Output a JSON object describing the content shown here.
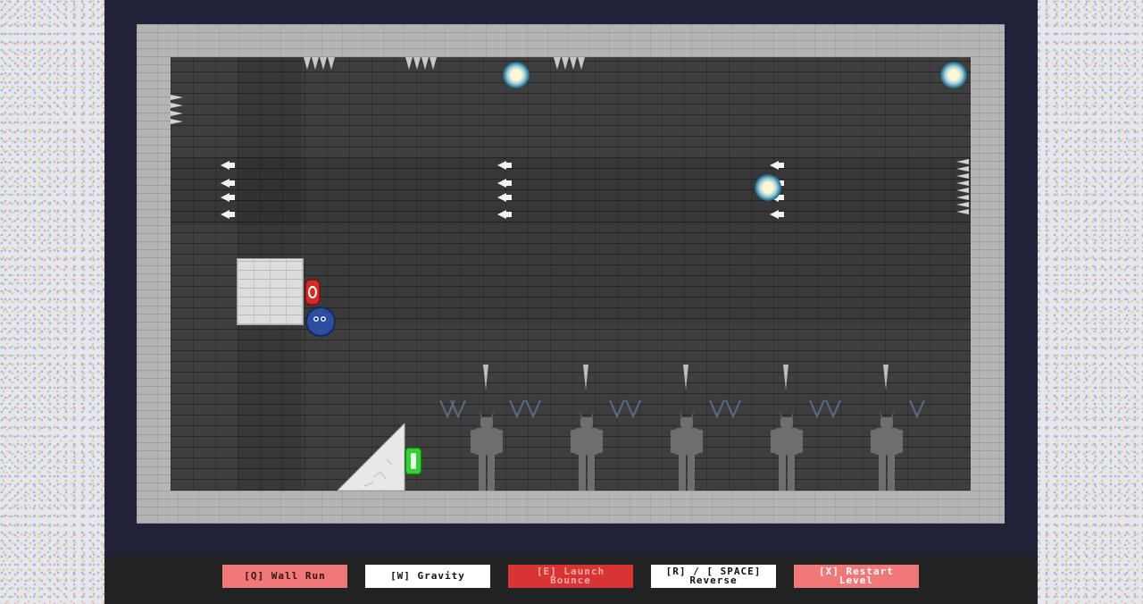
{
  "hud": {
    "abilities": [
      {
        "label": "[Q] Wall Run",
        "bg": "#f07878",
        "fg": "#3a1010"
      },
      {
        "label": "[W] Gravity",
        "bg": "#ffffff",
        "fg": "#111111"
      },
      {
        "label": "[E] Launch\nBounce",
        "bg": "#d83434",
        "fg": "#f4aaaa"
      },
      {
        "label": "[R] / [ SPACE]\nReverse",
        "bg": "#ffffff",
        "fg": "#111111"
      },
      {
        "label": "[X] Restart\nLevel",
        "bg": "#f07878",
        "fg": "#ffffff"
      }
    ]
  },
  "colors": {
    "frame": "#212138",
    "stone_wall": "#b4b4b4",
    "dungeon_bricks": "#3e3e3e",
    "player_blue": "#2b4f9e",
    "door_red": "#d42a2a",
    "exit_green": "#38cc38"
  }
}
